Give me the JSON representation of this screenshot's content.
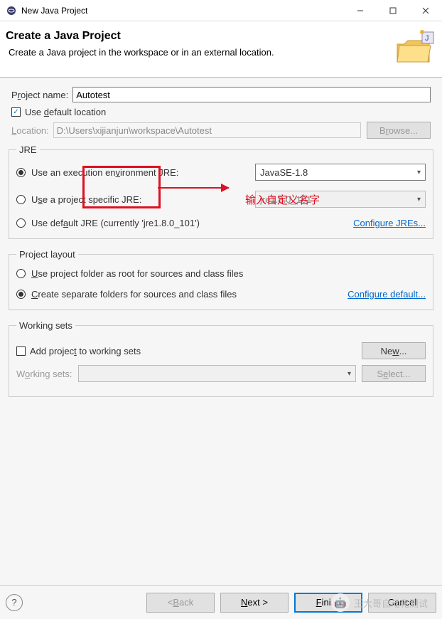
{
  "window": {
    "title": "New Java Project",
    "min": "—",
    "max": "□",
    "close": "✕"
  },
  "header": {
    "title": "Create a Java Project",
    "subtitle": "Create a Java project in the workspace or in an external location."
  },
  "project_name": {
    "label_pre": "P",
    "label_u": "r",
    "label_post": "oject name:",
    "value": "Autotest"
  },
  "default_location": {
    "checkbox_checked": "✓",
    "label_pre": "Use ",
    "label_u": "d",
    "label_post": "efault location"
  },
  "location": {
    "label_pre": "",
    "label_u": "L",
    "label_post": "ocation:",
    "value": "D:\\Users\\xijianjun\\workspace\\Autotest",
    "browse_pre": "B",
    "browse_u": "r",
    "browse_post": "owse..."
  },
  "jre": {
    "legend": "JRE",
    "opt1_pre": "Use an execution en",
    "opt1_u": "v",
    "opt1_post": "ironment JRE:",
    "opt1_value": "JavaSE-1.8",
    "opt2_pre": "U",
    "opt2_u": "s",
    "opt2_post": "e a project specific JRE:",
    "opt2_value": "jre1.8.0_101",
    "opt3_pre": "Use def",
    "opt3_u": "a",
    "opt3_post": "ult JRE (currently 'jre1.8.0_101')",
    "configure_pre": "Configure JR",
    "configure_u": "E",
    "configure_post": "s..."
  },
  "layout": {
    "legend": "Project layout",
    "opt1_pre": "",
    "opt1_u": "U",
    "opt1_post": "se project folder as root for sources and class files",
    "opt2_pre": "",
    "opt2_u": "C",
    "opt2_post": "reate separate folders for sources and class files",
    "configure_pre": "Configure de",
    "configure_u": "f",
    "configure_post": "ault..."
  },
  "working_sets": {
    "legend": "Working sets",
    "add_pre": "Add projec",
    "add_u": "t",
    "add_post": " to working sets",
    "new_pre": "Ne",
    "new_u": "w",
    "new_post": "...",
    "label_pre": "W",
    "label_u": "o",
    "label_post": "rking sets:",
    "select_pre": "S",
    "select_u": "e",
    "select_post": "lect..."
  },
  "footer": {
    "help": "?",
    "back_pre": "< ",
    "back_u": "B",
    "back_post": "ack",
    "next_pre": "",
    "next_u": "N",
    "next_post": "ext >",
    "finish_pre": "",
    "finish_u": "F",
    "finish_post": "inish",
    "cancel": "Cancel"
  },
  "annotation": "输入自定义名字",
  "watermark": "王大哥自动化测试"
}
